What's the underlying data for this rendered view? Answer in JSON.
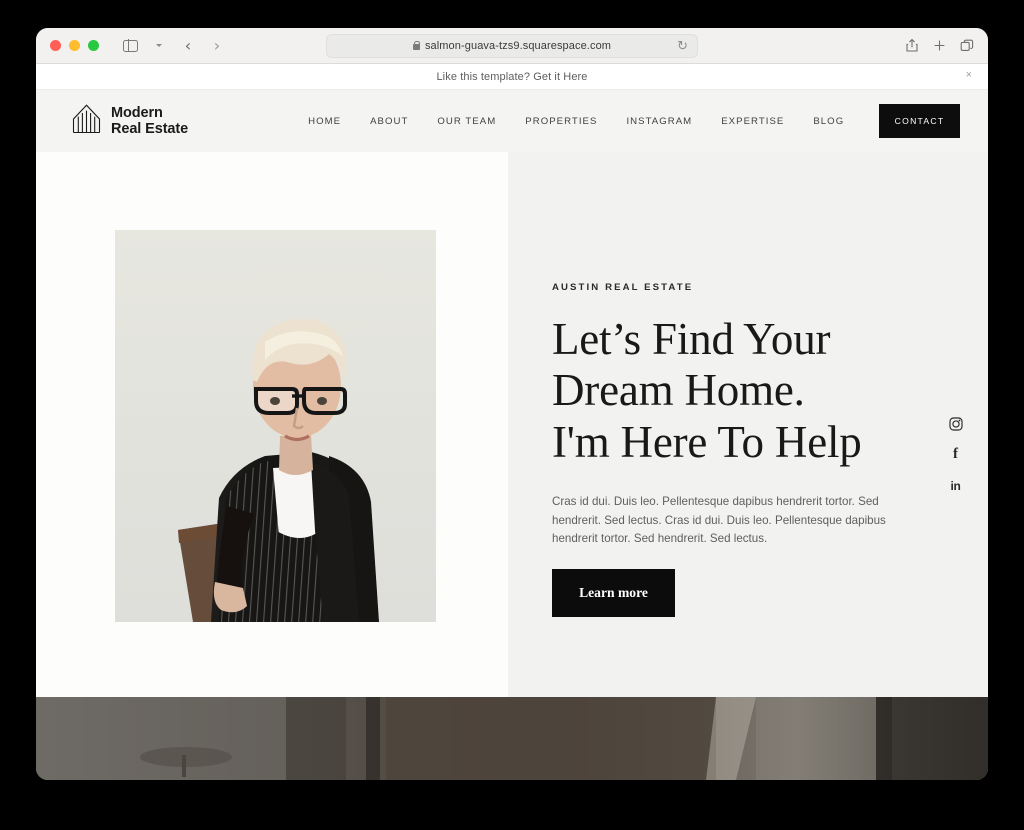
{
  "browser": {
    "traffic_lights": [
      "close",
      "minimize",
      "maximize"
    ],
    "sidebar_toggle": "sidebar-icon",
    "dropdown": "chevron-down-icon",
    "back_label": "‹",
    "forward_label": "›",
    "url": "salmon-guava-tzs9.squarespace.com",
    "reload_label": "↻",
    "share_label": "share-icon",
    "new_tab_label": "+",
    "tabs_label": "tabs-icon"
  },
  "promo": {
    "text": "Like this template? Get it Here",
    "close_label": "×"
  },
  "site": {
    "logo": {
      "line1": "Modern",
      "line2": "Real Estate",
      "icon": "building-icon"
    },
    "nav": [
      {
        "label": "HOME"
      },
      {
        "label": "ABOUT"
      },
      {
        "label": "OUR TEAM"
      },
      {
        "label": "PROPERTIES"
      },
      {
        "label": "INSTAGRAM"
      },
      {
        "label": "EXPERTISE"
      },
      {
        "label": "BLOG"
      }
    ],
    "contact_button": "CONTACT"
  },
  "hero": {
    "eyebrow": "AUSTIN REAL ESTATE",
    "headline_line1": "Let’s Find Your",
    "headline_line2": "Dream Home.",
    "headline_line3": "I'm Here To Help",
    "body": "Cras id dui. Duis leo. Pellentesque dapibus hendrerit tortor. Sed hendrerit. Sed lectus. Cras id dui. Duis leo. Pellentesque dapibus hendrerit tortor. Sed hendrerit. Sed lectus.",
    "cta": "Learn more",
    "portrait_alt": "Woman with blonde short hair wearing black glasses and pinstripe blazer",
    "socials": [
      {
        "name": "instagram",
        "glyph": "instagram-icon"
      },
      {
        "name": "facebook",
        "glyph": "f"
      },
      {
        "name": "linkedin",
        "glyph": "in"
      }
    ]
  },
  "colors": {
    "page_left_bg": "#fdfdfb",
    "page_right_bg": "#f2f2f0",
    "header_bg": "#f4f4f2",
    "accent_black": "#0d0d0d",
    "body_text": "#5f5f5f",
    "heading_text": "#191919"
  }
}
